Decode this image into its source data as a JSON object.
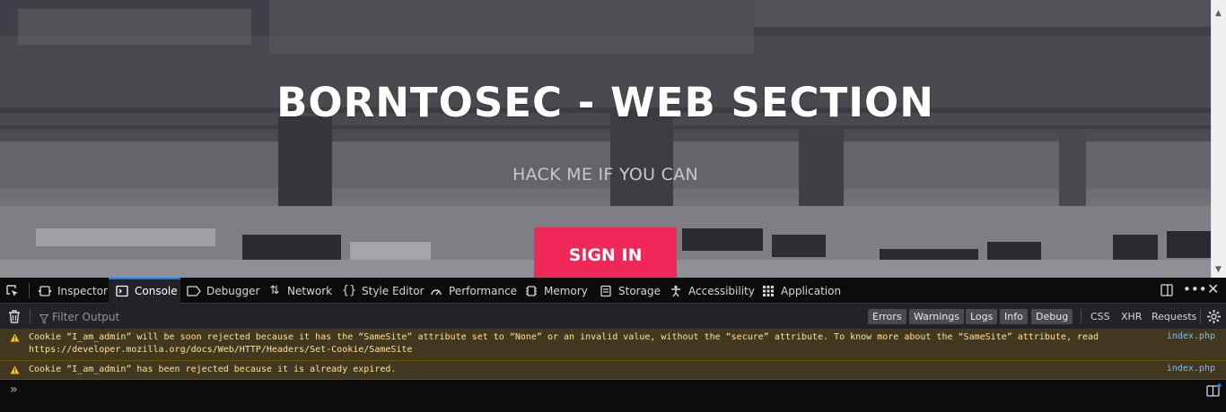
{
  "hero": {
    "title": "BORNTOSEC - WEB SECTION",
    "subtitle": "HACK ME IF YOU CAN",
    "signin_label": "SIGN IN",
    "accent_color": "#f0285a"
  },
  "devtools": {
    "tabs": [
      {
        "label": "Inspector",
        "icon": "inspector-icon"
      },
      {
        "label": "Console",
        "icon": "console-icon",
        "selected": true
      },
      {
        "label": "Debugger",
        "icon": "debugger-icon"
      },
      {
        "label": "Network",
        "icon": "network-icon"
      },
      {
        "label": "Style Editor",
        "icon": "style-editor-icon"
      },
      {
        "label": "Performance",
        "icon": "performance-icon"
      },
      {
        "label": "Memory",
        "icon": "memory-icon"
      },
      {
        "label": "Storage",
        "icon": "storage-icon"
      },
      {
        "label": "Accessibility",
        "icon": "accessibility-icon"
      },
      {
        "label": "Application",
        "icon": "application-icon"
      }
    ],
    "filter_placeholder": "Filter Output",
    "levels": [
      "Errors",
      "Warnings",
      "Logs",
      "Info",
      "Debug"
    ],
    "net_filters": [
      "CSS",
      "XHR",
      "Requests"
    ],
    "messages": [
      {
        "level": "warning",
        "line1": "Cookie “I_am_admin” will be soon rejected because it has the “SameSite” attribute set to “None” or an invalid value, without the “secure” attribute. To know more about the “SameSite” attribute, read",
        "line2": "https://developer.mozilla.org/docs/Web/HTTP/Headers/Set-Cookie/SameSite",
        "source": "index.php"
      },
      {
        "level": "warning",
        "line1": "Cookie “I_am_admin” has been rejected because it is already expired.",
        "source": "index.php"
      }
    ],
    "prompt_symbol": "»"
  }
}
